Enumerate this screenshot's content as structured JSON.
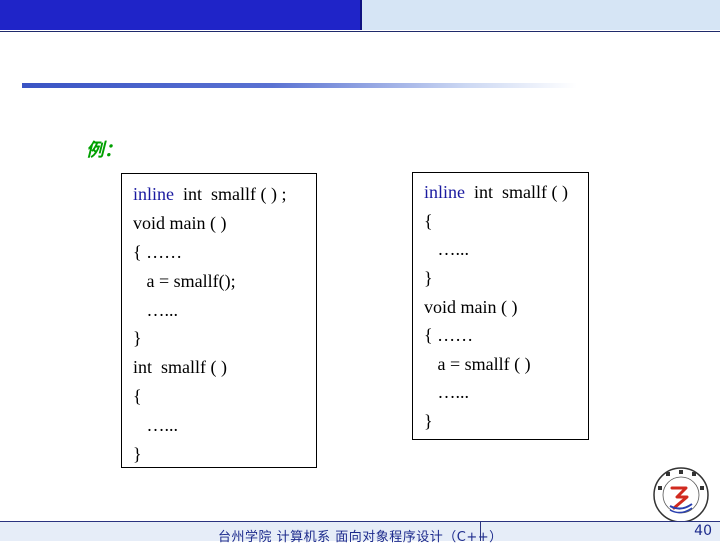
{
  "slide": {
    "example_label": "例：",
    "left_code": [
      {
        "kw": "inline",
        "rest": "  int  smallf ( ) ;"
      },
      {
        "kw": "",
        "rest": "void main ( )"
      },
      {
        "kw": "",
        "rest": "{ ……"
      },
      {
        "kw": "",
        "rest": "   a = smallf();"
      },
      {
        "kw": "",
        "rest": "   …..."
      },
      {
        "kw": "",
        "rest": "}"
      },
      {
        "kw": "",
        "rest": "int  smallf ( )"
      },
      {
        "kw": "",
        "rest": "{"
      },
      {
        "kw": "",
        "rest": "   …..."
      },
      {
        "kw": "",
        "rest": "}"
      }
    ],
    "right_code": [
      {
        "kw": "inline",
        "rest": "  int  smallf ( )"
      },
      {
        "kw": "",
        "rest": "{"
      },
      {
        "kw": "",
        "rest": "   …..."
      },
      {
        "kw": "",
        "rest": "}"
      },
      {
        "kw": "",
        "rest": "void main ( )"
      },
      {
        "kw": "",
        "rest": "{ ……"
      },
      {
        "kw": "",
        "rest": "   a = smallf ( )"
      },
      {
        "kw": "",
        "rest": "   …..."
      },
      {
        "kw": "",
        "rest": "}"
      }
    ],
    "footer": "台州学院 计算机系 面向对象程序设计（C++）",
    "page_number": "40",
    "logo_icon": "university-seal-icon",
    "colors": {
      "top_bar_left": "#1f24c8",
      "top_bar_right": "#d6e5f5",
      "example_label": "#00a000",
      "keyword": "#1a1aa0"
    }
  }
}
